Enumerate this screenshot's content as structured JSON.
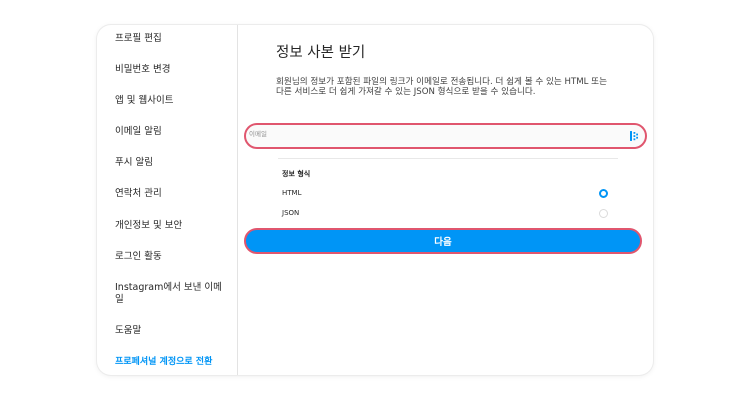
{
  "sidebar": {
    "items": [
      {
        "label": "프로필 편집"
      },
      {
        "label": "비밀번호 변경"
      },
      {
        "label": "앱 및 웹사이트"
      },
      {
        "label": "이메일 알림"
      },
      {
        "label": "푸시 알림"
      },
      {
        "label": "연락처 관리"
      },
      {
        "label": "개인정보 및 보안"
      },
      {
        "label": "로그인 활동"
      },
      {
        "label": "Instagram에서 보낸 이메일"
      },
      {
        "label": "도움말"
      }
    ],
    "professional_link": "프로페셔널 계정으로 전환"
  },
  "main": {
    "title": "정보 사본 받기",
    "description": "회원님의 정보가 포함된 파일의 링크가 이메일로 전송됩니다. 더 쉽게 볼 수 있는 HTML 또는 다른 서비스로 더 쉽게 가져갈 수 있는 JSON 형식으로 받을 수 있습니다.",
    "email": {
      "label": "이메일",
      "value": ""
    },
    "format": {
      "title": "정보 형식",
      "options": [
        {
          "label": "HTML",
          "selected": true
        },
        {
          "label": "JSON",
          "selected": false
        }
      ]
    },
    "next_label": "다음"
  },
  "colors": {
    "accent": "#0095f6",
    "highlight": "#e0566e"
  }
}
